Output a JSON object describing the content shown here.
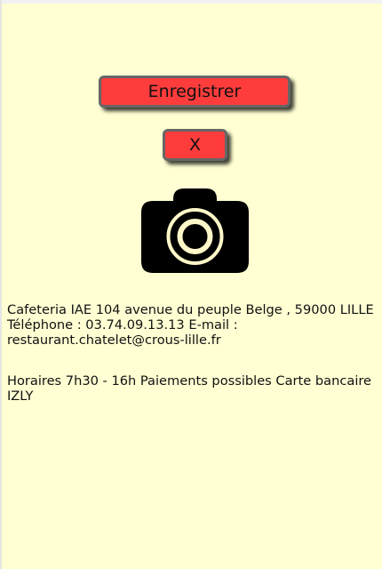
{
  "actions": {
    "save_label": "Enregistrer",
    "close_label": "X"
  },
  "camera": {
    "icon": "camera-icon"
  },
  "info": {
    "line1": "Cafeteria IAE 104 avenue du peuple Belge , 59000 LILLE",
    "line2": "Téléphone : 03.74.09.13.13 E-mail :",
    "line3": "restaurant.chatelet@crous-lille.fr",
    "hours_line1": "Horaires 7h30 - 16h Paiements possibles Carte bancaire",
    "hours_line2": "IZLY"
  },
  "colors": {
    "background": "#ffffd3",
    "button": "#ff3c3c",
    "button_border": "#666666",
    "camera_ring": "#fff7c8"
  }
}
